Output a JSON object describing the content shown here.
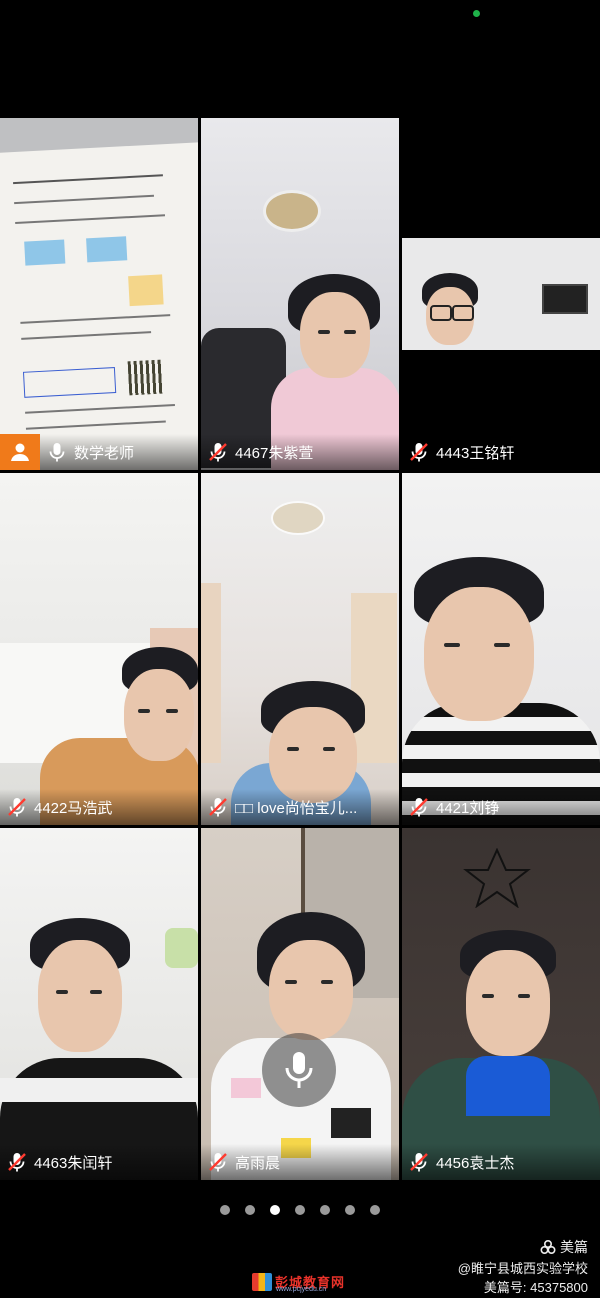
{
  "participants": [
    {
      "label": "数学老师",
      "mic": "on",
      "role": "host"
    },
    {
      "label": "4467朱紫萱",
      "mic": "off"
    },
    {
      "label": "4443王铭轩",
      "mic": "off"
    },
    {
      "label": "4422马浩武",
      "mic": "off"
    },
    {
      "label": "□□ love尚怡宝儿...",
      "mic": "off"
    },
    {
      "label": "4421刘铮",
      "mic": "off"
    },
    {
      "label": "4463朱闰轩",
      "mic": "off"
    },
    {
      "label": "高雨晨",
      "mic": "off"
    },
    {
      "label": "4456袁士杰",
      "mic": "off"
    }
  ],
  "pagination": {
    "total": 7,
    "active": 3
  },
  "watermark": {
    "brand": "美篇",
    "author": "@睢宁县城西实验学校",
    "id_line": "美篇号: 45375800",
    "site_name": "彭城教育网",
    "site_url": "www.pcjyedu.cn"
  },
  "colors": {
    "host_badge": "#f07a1a",
    "status_dot": "#1fb24a",
    "mic_muted": "#ff3b30"
  }
}
